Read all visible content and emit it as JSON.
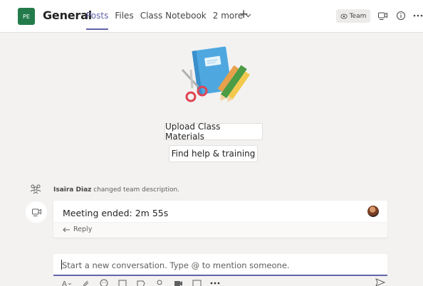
{
  "header": {
    "team_initials": "PE",
    "channel_name": "General",
    "tabs": [
      {
        "label": "Posts"
      },
      {
        "label": "Files"
      },
      {
        "label": "Class Notebook"
      }
    ],
    "more_label": "2 more",
    "add_symbol": "+",
    "team_pill_label": "Team",
    "icons": [
      "eye-icon",
      "meet-icon",
      "info-icon",
      "more-icon"
    ]
  },
  "welcome": {
    "upload_label": "Upload Class Materials",
    "help_label": "Find help & training"
  },
  "feed": {
    "activity": {
      "actor": "Isaira Diaz",
      "action": "changed team description."
    },
    "meeting": {
      "title": "Meeting ended: 2m 55s",
      "reply_label": "Reply"
    }
  },
  "compose": {
    "placeholder": "Start a new conversation. Type @ to mention someone.",
    "tools": [
      "format-icon",
      "attach-icon",
      "emoji-icon",
      "gif-icon",
      "sticker-icon",
      "praise-icon",
      "meet-now-icon",
      "stream-icon",
      "more-options-icon",
      "send-icon"
    ]
  },
  "colors": {
    "accent": "#6264a7",
    "team_avatar": "#237b4b",
    "background": "#f3f2f1"
  }
}
